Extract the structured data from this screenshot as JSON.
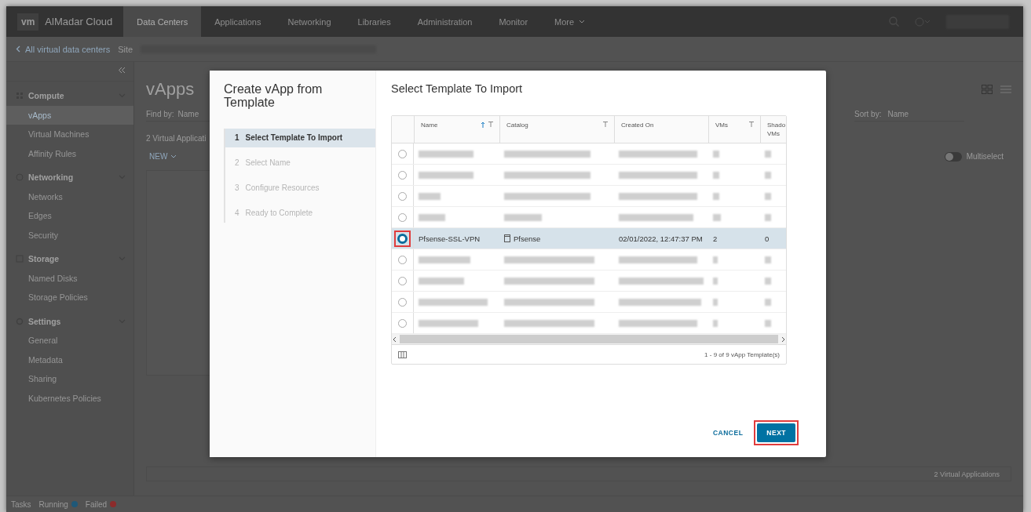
{
  "nav": {
    "logo": "vm",
    "brand": "AlMadar Cloud",
    "tabs": [
      {
        "label": "Data Centers",
        "selected": true
      },
      {
        "label": "Applications",
        "selected": false
      },
      {
        "label": "Networking",
        "selected": false
      },
      {
        "label": "Libraries",
        "selected": false
      },
      {
        "label": "Administration",
        "selected": false
      },
      {
        "label": "Monitor",
        "selected": false
      },
      {
        "label": "More",
        "selected": false
      }
    ]
  },
  "breadcrumb": {
    "back_link": "All virtual data centers",
    "site_label": "Site"
  },
  "sidebar": {
    "groups": [
      {
        "label": "Compute",
        "expanded": true,
        "items": [
          {
            "label": "vApps",
            "selected": true
          },
          {
            "label": "Virtual Machines",
            "selected": false
          },
          {
            "label": "Affinity Rules",
            "selected": false
          }
        ]
      },
      {
        "label": "Networking",
        "expanded": true,
        "items": [
          {
            "label": "Networks",
            "selected": false
          },
          {
            "label": "Edges",
            "selected": false
          },
          {
            "label": "Security",
            "selected": false
          }
        ]
      },
      {
        "label": "Storage",
        "expanded": true,
        "items": [
          {
            "label": "Named Disks",
            "selected": false
          },
          {
            "label": "Storage Policies",
            "selected": false
          }
        ]
      },
      {
        "label": "Settings",
        "expanded": true,
        "items": [
          {
            "label": "General",
            "selected": false
          },
          {
            "label": "Metadata",
            "selected": false
          },
          {
            "label": "Sharing",
            "selected": false
          },
          {
            "label": "Kubernetes Policies",
            "selected": false
          }
        ]
      }
    ]
  },
  "content": {
    "title": "vApps",
    "find_by": {
      "label": "Find by:",
      "value": "Name"
    },
    "count": "2 Virtual Applicati",
    "new_button": "NEW",
    "sort_by": {
      "label": "Sort by:",
      "value": "Name"
    },
    "multiselect": {
      "label": "Multiselect",
      "on": false
    },
    "footer": "2 Virtual Applications"
  },
  "wizard": {
    "title": "Create vApp from Template",
    "steps": [
      {
        "number": "1",
        "label": "Select Template To Import",
        "selected": true
      },
      {
        "number": "2",
        "label": "Select Name",
        "selected": false
      },
      {
        "number": "3",
        "label": "Configure Resources",
        "selected": false
      },
      {
        "number": "4",
        "label": "Ready to Complete",
        "selected": false
      }
    ],
    "page_title": "Select Template To Import",
    "table": {
      "columns": [
        {
          "label": "Name",
          "sorted": true,
          "filter": true
        },
        {
          "label": "Catalog",
          "filter": true
        },
        {
          "label": "Created On"
        },
        {
          "label": "VMs",
          "filter": true
        },
        {
          "label": "Shado VMs"
        }
      ],
      "rows": [
        {
          "kind": "redacted",
          "selected": false,
          "highlighted": false
        },
        {
          "kind": "redacted",
          "selected": false,
          "highlighted": false
        },
        {
          "kind": "redacted",
          "selected": false,
          "highlighted": false
        },
        {
          "kind": "redacted",
          "selected": false,
          "highlighted": false
        },
        {
          "kind": "data",
          "selected": true,
          "highlighted": true,
          "cells": [
            "Pfsense-SSL-VPN",
            "Pfsense",
            "02/01/2022, 12:47:37 PM",
            "2",
            "0"
          ]
        },
        {
          "kind": "redacted",
          "selected": false,
          "highlighted": false
        },
        {
          "kind": "redacted",
          "selected": false,
          "highlighted": false
        },
        {
          "kind": "redacted",
          "selected": false,
          "highlighted": false
        },
        {
          "kind": "redacted",
          "selected": false,
          "highlighted": false
        }
      ],
      "footer": "1 - 9 of 9 vApp Template(s)"
    },
    "buttons": [
      {
        "label": "CANCEL",
        "kind": "link",
        "highlighted": false
      },
      {
        "label": "NEXT",
        "kind": "primary",
        "highlighted": true
      }
    ]
  },
  "taskbar": {
    "items": [
      {
        "label": "Tasks"
      },
      {
        "label": "Running",
        "color": "#1f5878"
      },
      {
        "label": "Failed",
        "color": "#8c2b2b"
      }
    ]
  }
}
